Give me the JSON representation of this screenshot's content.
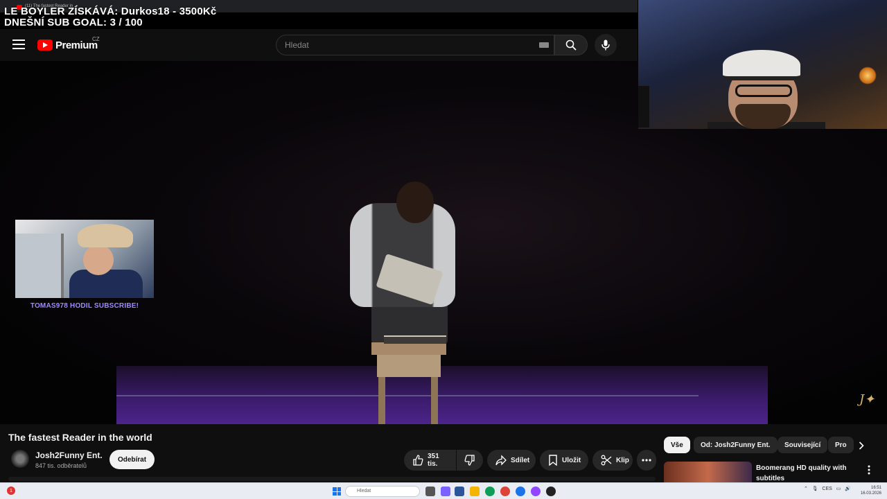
{
  "browser": {
    "tab_title": "(11) The fastest Reader in ..."
  },
  "overlay": {
    "line1": "LE BOYLER ZÍSKÁVÁ: Durkos18 - 3500Kč",
    "line2": "DNEŠNÍ SUB GOAL: 3 / 100"
  },
  "header": {
    "logo_text": "Premium",
    "region": "CZ",
    "search_placeholder": "Hledat"
  },
  "alert": {
    "text": "TOMAS978 HODIL SUBSCRIBE!"
  },
  "video": {
    "title": "The fastest Reader in the world",
    "channel_name": "Josh2Funny Ent.",
    "subscribers": "847 tis. odběratelů",
    "subscribe_label": "Odebírat",
    "likes": "351 tis.",
    "share_label": "Sdílet",
    "save_label": "Uložit",
    "clip_label": "Klip"
  },
  "chips": [
    "Vše",
    "Od: Josh2Funny Ent.",
    "Související",
    "Pro"
  ],
  "recommendation": {
    "title": "Boomerang HD quality with subtitles"
  },
  "taskbar": {
    "search_placeholder": "Hledat",
    "notification_count": "1",
    "language": "CES",
    "time": "16:51",
    "date": "16.03.2026"
  },
  "colors": {
    "yt_red": "#ff0000",
    "alert_purple": "#9c8cff",
    "stage_purple": "#4c248a"
  }
}
